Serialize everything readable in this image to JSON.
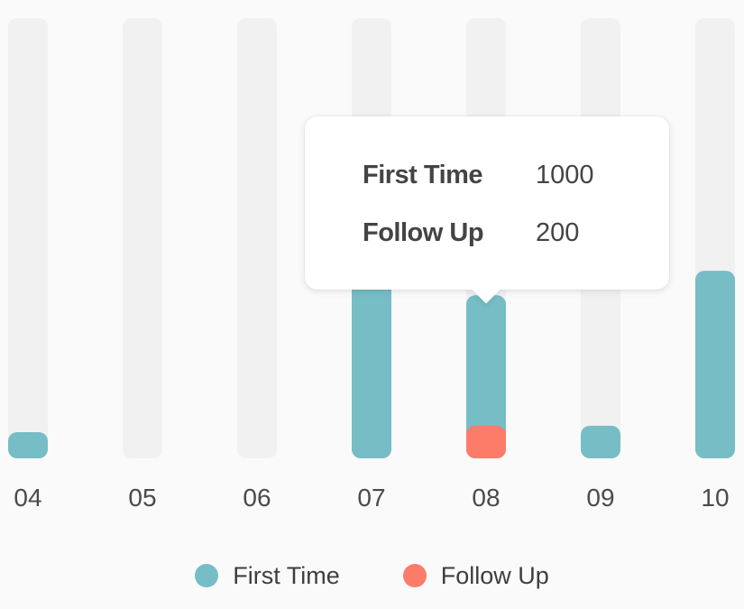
{
  "colors": {
    "first_time": "#76bdc6",
    "follow_up": "#fd7b69",
    "track": "#f1f1f1"
  },
  "chart_data": {
    "type": "bar",
    "stacked": false,
    "categories": [
      "04",
      "05",
      "06",
      "07",
      "08",
      "09",
      "10"
    ],
    "series": [
      {
        "name": "First Time",
        "values": [
          160,
          0,
          0,
          1700,
          1000,
          200,
          1150
        ]
      },
      {
        "name": "Follow Up",
        "values": [
          0,
          0,
          0,
          0,
          200,
          0,
          0
        ]
      }
    ],
    "ylim": [
      0,
      2700
    ],
    "grid": false,
    "legend_position": "bottom-center",
    "xlabel": "",
    "ylabel": ""
  },
  "legend": {
    "items": [
      {
        "label": "First Time",
        "color": "#76bdc6"
      },
      {
        "label": "Follow Up",
        "color": "#fd7b69"
      }
    ]
  },
  "tooltip": {
    "category": "08",
    "rows": [
      {
        "label": "First Time",
        "value": "1000"
      },
      {
        "label": "Follow Up",
        "value": "200"
      }
    ]
  }
}
